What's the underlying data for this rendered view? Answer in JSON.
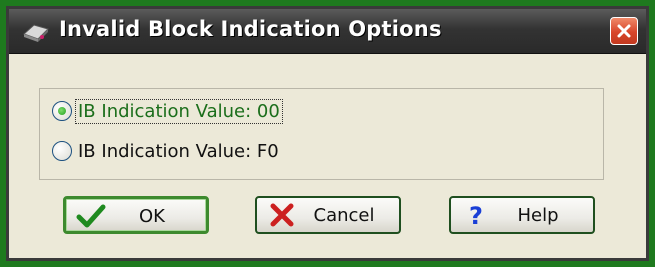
{
  "window": {
    "title": "Invalid Block Indication Options",
    "title_icon": "drive-icon",
    "close_icon": "close-icon",
    "frame_color": "#1e7a1e",
    "title_bar_color": "#333333"
  },
  "options": {
    "items": [
      {
        "label": "IB Indication Value: 00",
        "selected": true
      },
      {
        "label": "IB Indication Value: F0",
        "selected": false
      }
    ],
    "selected_index": 0
  },
  "buttons": {
    "ok": {
      "label": "OK",
      "icon": "checkmark-icon",
      "default": true
    },
    "cancel": {
      "label": "Cancel",
      "icon": "x-mark-icon"
    },
    "help": {
      "label": "Help",
      "icon": "question-mark-icon"
    }
  }
}
